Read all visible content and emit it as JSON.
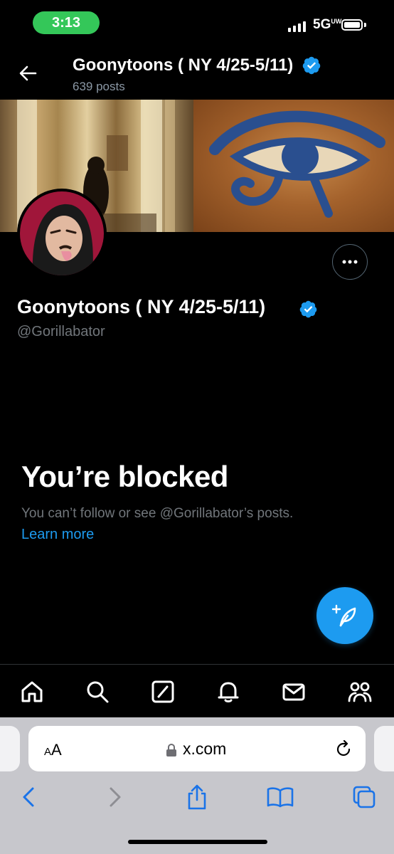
{
  "status_bar": {
    "time": "3:13",
    "network": "5G",
    "network_sup": "UW"
  },
  "header": {
    "name": "Goonytoons ( NY 4/25-5/11)",
    "posts": "639 posts"
  },
  "profile": {
    "name": "Goonytoons ( NY 4/25-5/11)",
    "handle": "@Gorillabator"
  },
  "blocked": {
    "title": "You’re blocked",
    "description": "You can’t follow or see @Gorillabator’s posts.",
    "learn_more": "Learn more"
  },
  "tabbar": {
    "items": [
      "home-icon",
      "search-icon",
      "grok-icon",
      "notifications-icon",
      "messages-icon",
      "communities-icon"
    ]
  },
  "browser": {
    "aa_label_small": "A",
    "aa_label": "A",
    "url": "x.com"
  },
  "colors": {
    "accent": "#1d9bf0",
    "status_green": "#34c759",
    "background": "#000000"
  }
}
